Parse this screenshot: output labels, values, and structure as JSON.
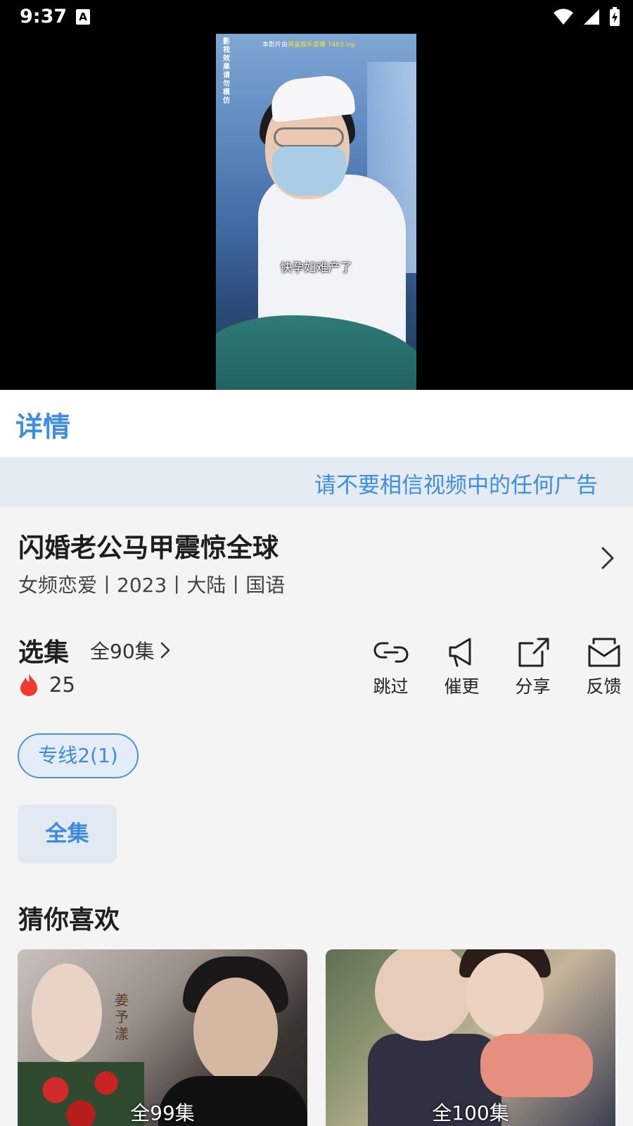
{
  "status_bar": {
    "time": "9:37",
    "notification_icon": "A"
  },
  "video": {
    "side_note": "影视效果 请勿模仿",
    "top_note_prefix": "本影片由",
    "top_note_highlight": "英皇娱乐直播 7463.vip",
    "subtitle": "快孕妇难产了"
  },
  "details": {
    "title": "详情"
  },
  "warning": "请不要相信视频中的任何广告",
  "show": {
    "name": "闪婚老公马甲震惊全球",
    "meta": "女频恋爱丨2023丨大陆丨国语"
  },
  "episodes": {
    "label": "选集",
    "total": "全90集",
    "hot_count": "25"
  },
  "actions": [
    {
      "label": "跳过",
      "icon": "link-icon"
    },
    {
      "label": "催更",
      "icon": "megaphone-icon"
    },
    {
      "label": "分享",
      "icon": "share-icon"
    },
    {
      "label": "反馈",
      "icon": "mail-icon"
    }
  ],
  "line_chip": "专线2(1)",
  "all_chip": "全集",
  "guess": {
    "title": "猜你喜欢",
    "cards": [
      {
        "episodes": "全99集",
        "poster_text": "姜予漾"
      },
      {
        "episodes": "全100集"
      }
    ]
  },
  "colors": {
    "accent": "#3f8fe0",
    "warning_bg": "#e5ebf3",
    "hot": "#f03a2e"
  }
}
